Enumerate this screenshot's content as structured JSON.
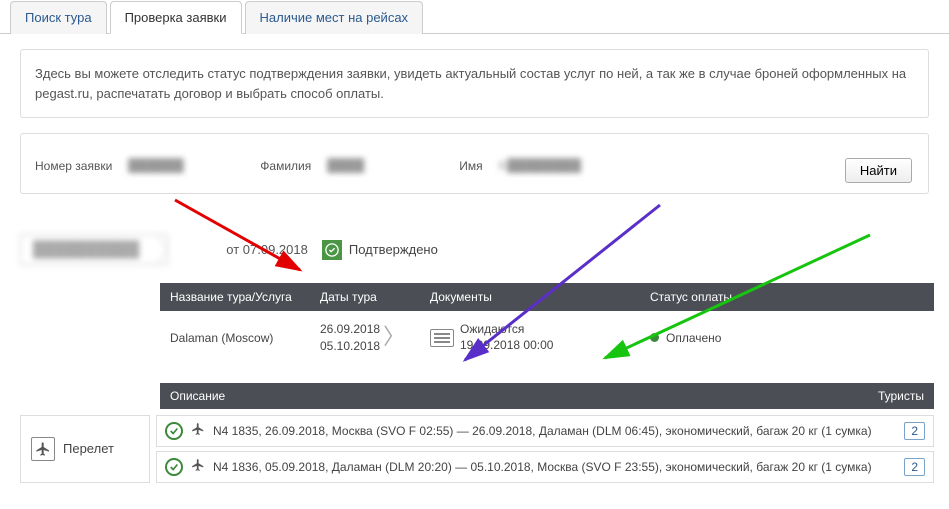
{
  "tabs": {
    "search": "Поиск тура",
    "check": "Проверка заявки",
    "seats": "Наличие мест на рейсах"
  },
  "info_text": "Здесь вы можете отследить статус подтверждения заявки, увидеть актуальный состав услуг по ней, а так же в случае броней оформленных на pegast.ru, распечатать договор и выбрать способ оплаты.",
  "search": {
    "num_label": "Номер заявки",
    "num_value": "██████",
    "surname_label": "Фамилия",
    "surname_value": "████",
    "name_label": "Имя",
    "name_value": "K████████",
    "find": "Найти"
  },
  "status": {
    "ticket": "██████████",
    "date_from": "от 07.09.2018",
    "confirmed": "Подтверждено"
  },
  "headers": {
    "tour": "Название тура/Услуга",
    "dates": "Даты тура",
    "docs": "Документы",
    "pay": "Статус оплаты"
  },
  "row": {
    "tour": "Dalaman (Moscow)",
    "date1": "26.09.2018",
    "date2": "05.10.2018",
    "docs_status": "Ожидаются",
    "docs_date": "19.09.2018 00:00",
    "pay_status": "Оплачено"
  },
  "section": {
    "desc": "Описание",
    "tourists": "Туристы",
    "flight_label": "Перелет"
  },
  "flights": [
    {
      "text": "N4 1835, 26.09.2018, Москва (SVO F 02:55) — 26.09.2018, Даламан (DLM 06:45), экономический, багаж 20 кг (1 сумка)",
      "count": "2"
    },
    {
      "text": "N4 1836, 05.09.2018, Даламан (DLM 20:20) — 05.10.2018, Москва (SVO F 23:55), экономический, багаж 20 кг (1 сумка)",
      "count": "2"
    }
  ]
}
